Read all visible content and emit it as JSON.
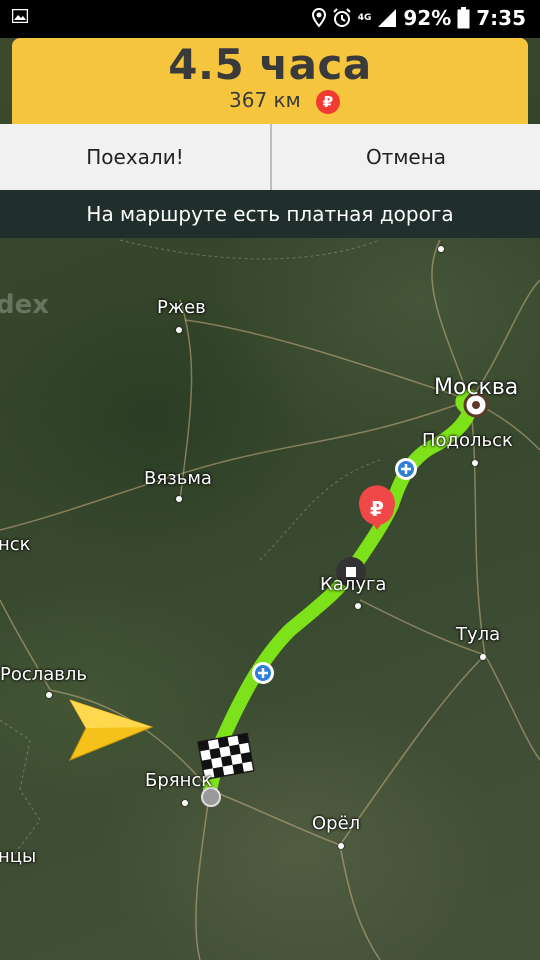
{
  "status_bar": {
    "battery": "92%",
    "time": "7:35",
    "network": "4G",
    "icons": [
      "gallery-icon",
      "location-icon",
      "alarm-icon",
      "signal-icon",
      "battery-icon"
    ]
  },
  "route": {
    "duration": "4.5 часа",
    "distance": "367 км",
    "toll_symbol": "₽"
  },
  "buttons": {
    "go": "Поехали!",
    "cancel": "Отмена"
  },
  "notice": "На маршруте есть платная дорога",
  "map": {
    "watermark": "dex",
    "cities": {
      "rzhev": "Ржев",
      "vyazma": "Вязьма",
      "moscow": "Москва",
      "podolsk": "Подольск",
      "kaluga": "Калуга",
      "tula": "Тула",
      "roslavl": "Рославль",
      "bryansk": "Брянск",
      "orel": "Орёл",
      "nsk": "нск",
      "ntsy": "нцы"
    },
    "route_color": "#7ee21a",
    "toll_marker_color": "#f04848",
    "arrow_color": "#f5c21b"
  }
}
